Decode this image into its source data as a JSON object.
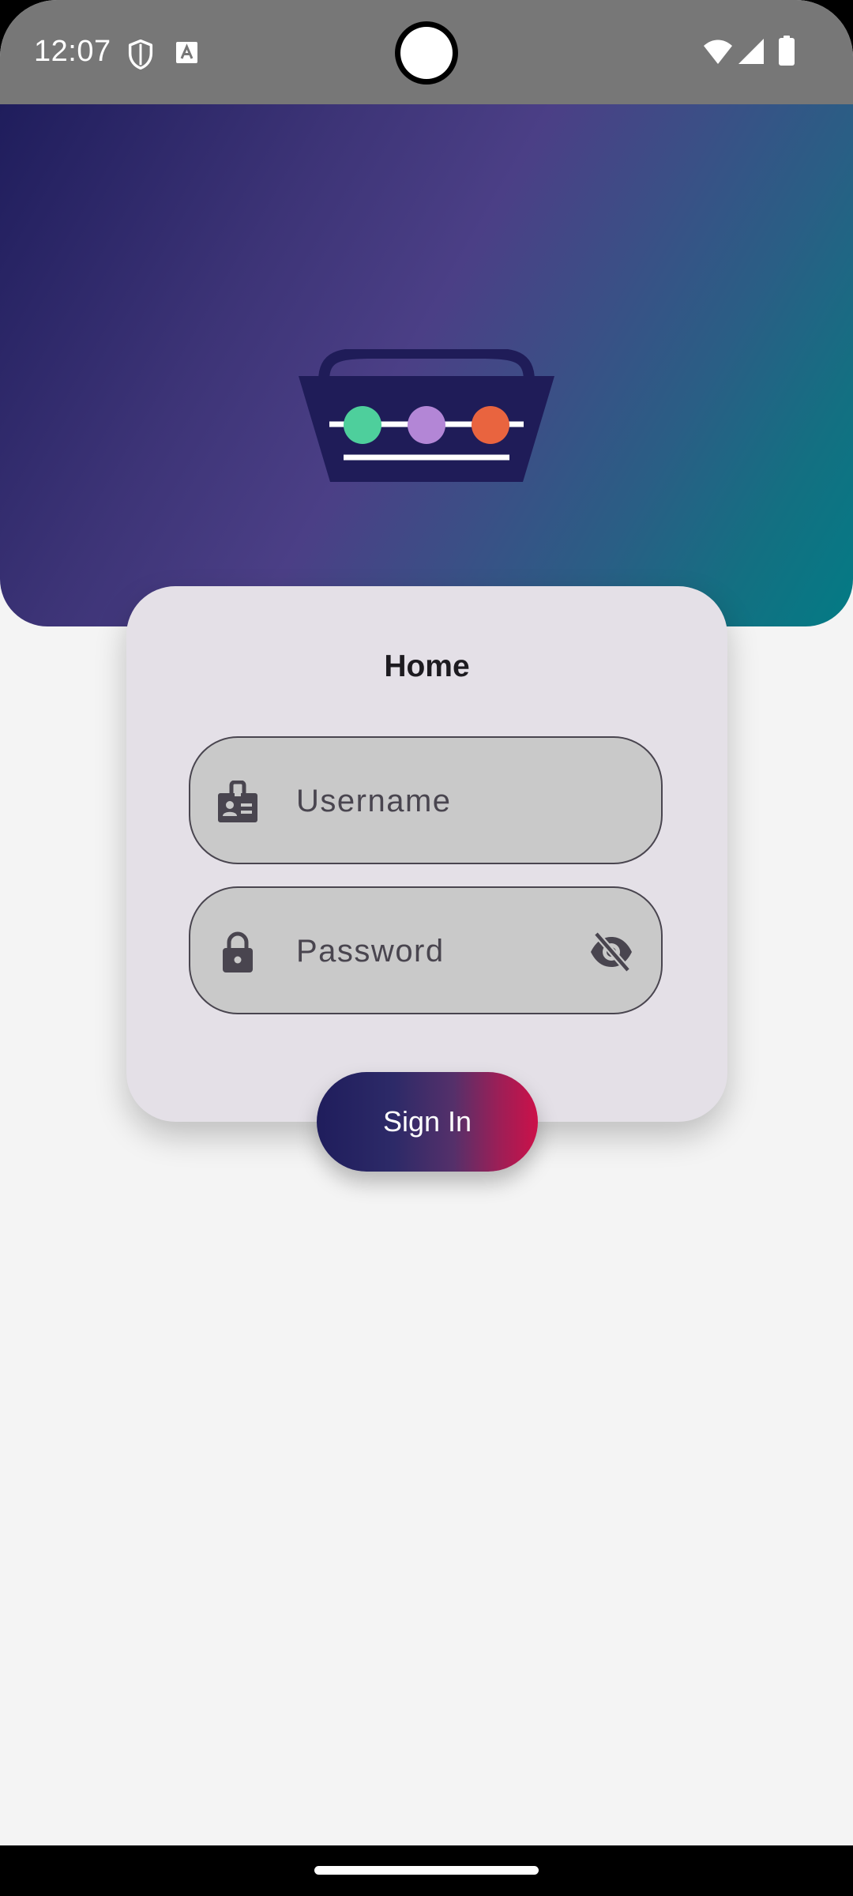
{
  "status_bar": {
    "time": "12:07",
    "icons": [
      "shield-icon",
      "text-a-icon",
      "wifi-icon",
      "signal-icon",
      "battery-icon"
    ]
  },
  "hero": {
    "logo": "basket-logo-icon",
    "logo_dot_colors": [
      "#4ecf9c",
      "#b386d6",
      "#e9643f"
    ]
  },
  "login_card": {
    "title": "Home",
    "username": {
      "value": "",
      "placeholder": "Username",
      "icon": "badge-icon"
    },
    "password": {
      "value": "",
      "placeholder": "Password",
      "icon": "lock-icon",
      "toggle_icon": "visibility-off-icon"
    },
    "sign_in_label": "Sign In"
  },
  "colors": {
    "hero_gradient_start": "#1f1d5c",
    "hero_gradient_end": "#037b85",
    "button_gradient_start": "#1f1d5c",
    "button_gradient_end": "#cc1149",
    "card_background": "#e4e0e7",
    "field_background": "#c9c9c9"
  }
}
